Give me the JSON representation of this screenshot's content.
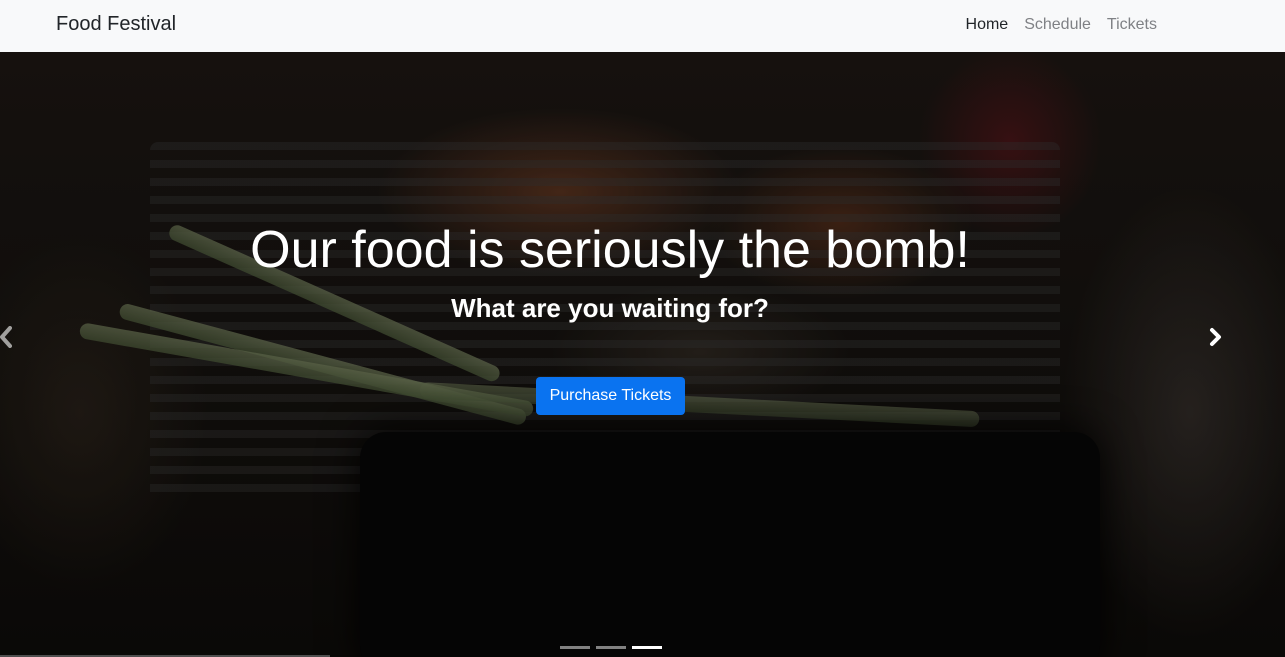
{
  "navbar": {
    "brand": "Food Festival",
    "links": [
      {
        "label": "Home",
        "active": true
      },
      {
        "label": "Schedule",
        "active": false
      },
      {
        "label": "Tickets",
        "active": false
      }
    ]
  },
  "hero": {
    "headline": "Our food is seriously the bomb!",
    "subheadline": "What are you waiting for?",
    "cta_label": "Purchase Tickets"
  },
  "carousel": {
    "prev_icon": "chevron-left-icon",
    "next_icon": "chevron-right-icon",
    "slide_count": 3,
    "active_slide": 3
  },
  "colors": {
    "navbar_bg": "#f8f9fa",
    "primary": "#0a73f0",
    "nav_muted": "#7f8185"
  }
}
